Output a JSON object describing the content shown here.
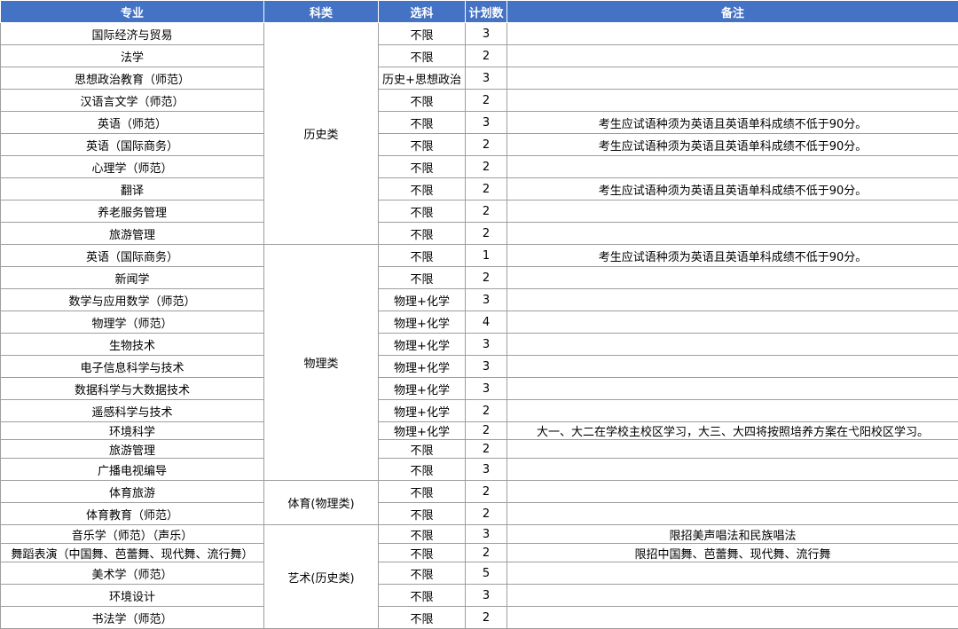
{
  "headers": [
    "专业",
    "科类",
    "选科",
    "计划数",
    "备注"
  ],
  "categories": [
    "历史类",
    "物理类",
    "体育(物理类)",
    "艺术(历史类)"
  ],
  "rows": [
    {
      "major": "国际经济与贸易",
      "subject": "不限",
      "plan": "3",
      "remark": ""
    },
    {
      "major": "法学",
      "subject": "不限",
      "plan": "2",
      "remark": ""
    },
    {
      "major": "思想政治教育（师范）",
      "subject": "历史+思想政治",
      "plan": "3",
      "remark": ""
    },
    {
      "major": "汉语言文学（师范）",
      "subject": "不限",
      "plan": "2",
      "remark": ""
    },
    {
      "major": "英语（师范）",
      "subject": "不限",
      "plan": "3",
      "remark": "考生应试语种须为英语且英语单科成绩不低于90分。"
    },
    {
      "major": "英语（国际商务）",
      "subject": "不限",
      "plan": "2",
      "remark": "考生应试语种须为英语且英语单科成绩不低于90分。"
    },
    {
      "major": "心理学（师范）",
      "subject": "不限",
      "plan": "2",
      "remark": ""
    },
    {
      "major": "翻译",
      "subject": "不限",
      "plan": "2",
      "remark": "考生应试语种须为英语且英语单科成绩不低于90分。"
    },
    {
      "major": "养老服务管理",
      "subject": "不限",
      "plan": "2",
      "remark": ""
    },
    {
      "major": "旅游管理",
      "subject": "不限",
      "plan": "2",
      "remark": ""
    },
    {
      "major": "英语（国际商务）",
      "subject": "不限",
      "plan": "1",
      "remark": "考生应试语种须为英语且英语单科成绩不低于90分。"
    },
    {
      "major": "新闻学",
      "subject": "不限",
      "plan": "2",
      "remark": ""
    },
    {
      "major": "数学与应用数学（师范）",
      "subject": "物理+化学",
      "plan": "3",
      "remark": ""
    },
    {
      "major": "物理学（师范）",
      "subject": "物理+化学",
      "plan": "4",
      "remark": ""
    },
    {
      "major": "生物技术",
      "subject": "物理+化学",
      "plan": "3",
      "remark": ""
    },
    {
      "major": "电子信息科学与技术",
      "subject": "物理+化学",
      "plan": "3",
      "remark": ""
    },
    {
      "major": "数据科学与大数据技术",
      "subject": "物理+化学",
      "plan": "3",
      "remark": ""
    },
    {
      "major": "遥感科学与技术",
      "subject": "物理+化学",
      "plan": "2",
      "remark": ""
    },
    {
      "major": "环境科学",
      "subject": "物理+化学",
      "plan": "2",
      "remark": "大一、大二在学校主校区学习，大三、大四将按照培养方案在弋阳校区学习。"
    },
    {
      "major": "旅游管理",
      "subject": "不限",
      "plan": "2",
      "remark": ""
    },
    {
      "major": "广播电视编导",
      "subject": "不限",
      "plan": "3",
      "remark": ""
    },
    {
      "major": "体育旅游",
      "subject": "不限",
      "plan": "2",
      "remark": ""
    },
    {
      "major": "体育教育（师范）",
      "subject": "不限",
      "plan": "2",
      "remark": ""
    },
    {
      "major": "音乐学（师范）（声乐）",
      "subject": "不限",
      "plan": "3",
      "remark": "限招美声唱法和民族唱法"
    },
    {
      "major": "舞蹈表演（中国舞、芭蕾舞、现代舞、流行舞）",
      "subject": "不限",
      "plan": "2",
      "remark": "限招中国舞、芭蕾舞、现代舞、流行舞"
    },
    {
      "major": "美术学（师范）",
      "subject": "不限",
      "plan": "5",
      "remark": ""
    },
    {
      "major": "环境设计",
      "subject": "不限",
      "plan": "3",
      "remark": ""
    },
    {
      "major": "书法学（师范）",
      "subject": "不限",
      "plan": "2",
      "remark": ""
    }
  ]
}
